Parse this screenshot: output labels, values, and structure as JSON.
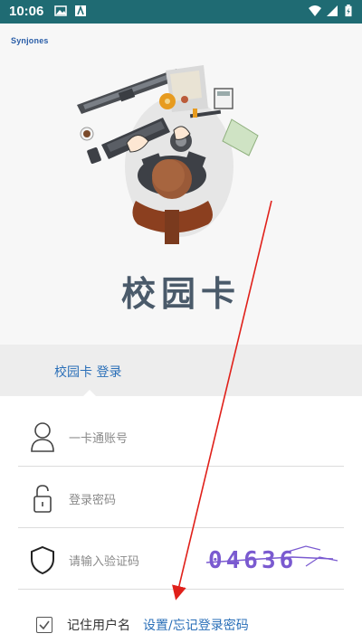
{
  "status_bar": {
    "time": "10:06",
    "icons": [
      "image-icon",
      "app-icon",
      "wifi-icon",
      "signal-icon",
      "battery-charging-icon"
    ]
  },
  "header": {
    "logo_text": "Synjones",
    "app_title": "校园卡"
  },
  "tabs": {
    "login_label": "校园卡 登录"
  },
  "form": {
    "account_placeholder": "一卡通账号",
    "password_placeholder": "登录密码",
    "captcha_placeholder": "请输入验证码",
    "captcha_text": "04636",
    "remember_label": "记住用户名",
    "forgot_link": "设置/忘记登录密码"
  },
  "colors": {
    "status_bar": "#1f6b73",
    "link": "#2a6fb8",
    "captcha": "#7a5ad0",
    "annotation_arrow": "#e0201a"
  }
}
